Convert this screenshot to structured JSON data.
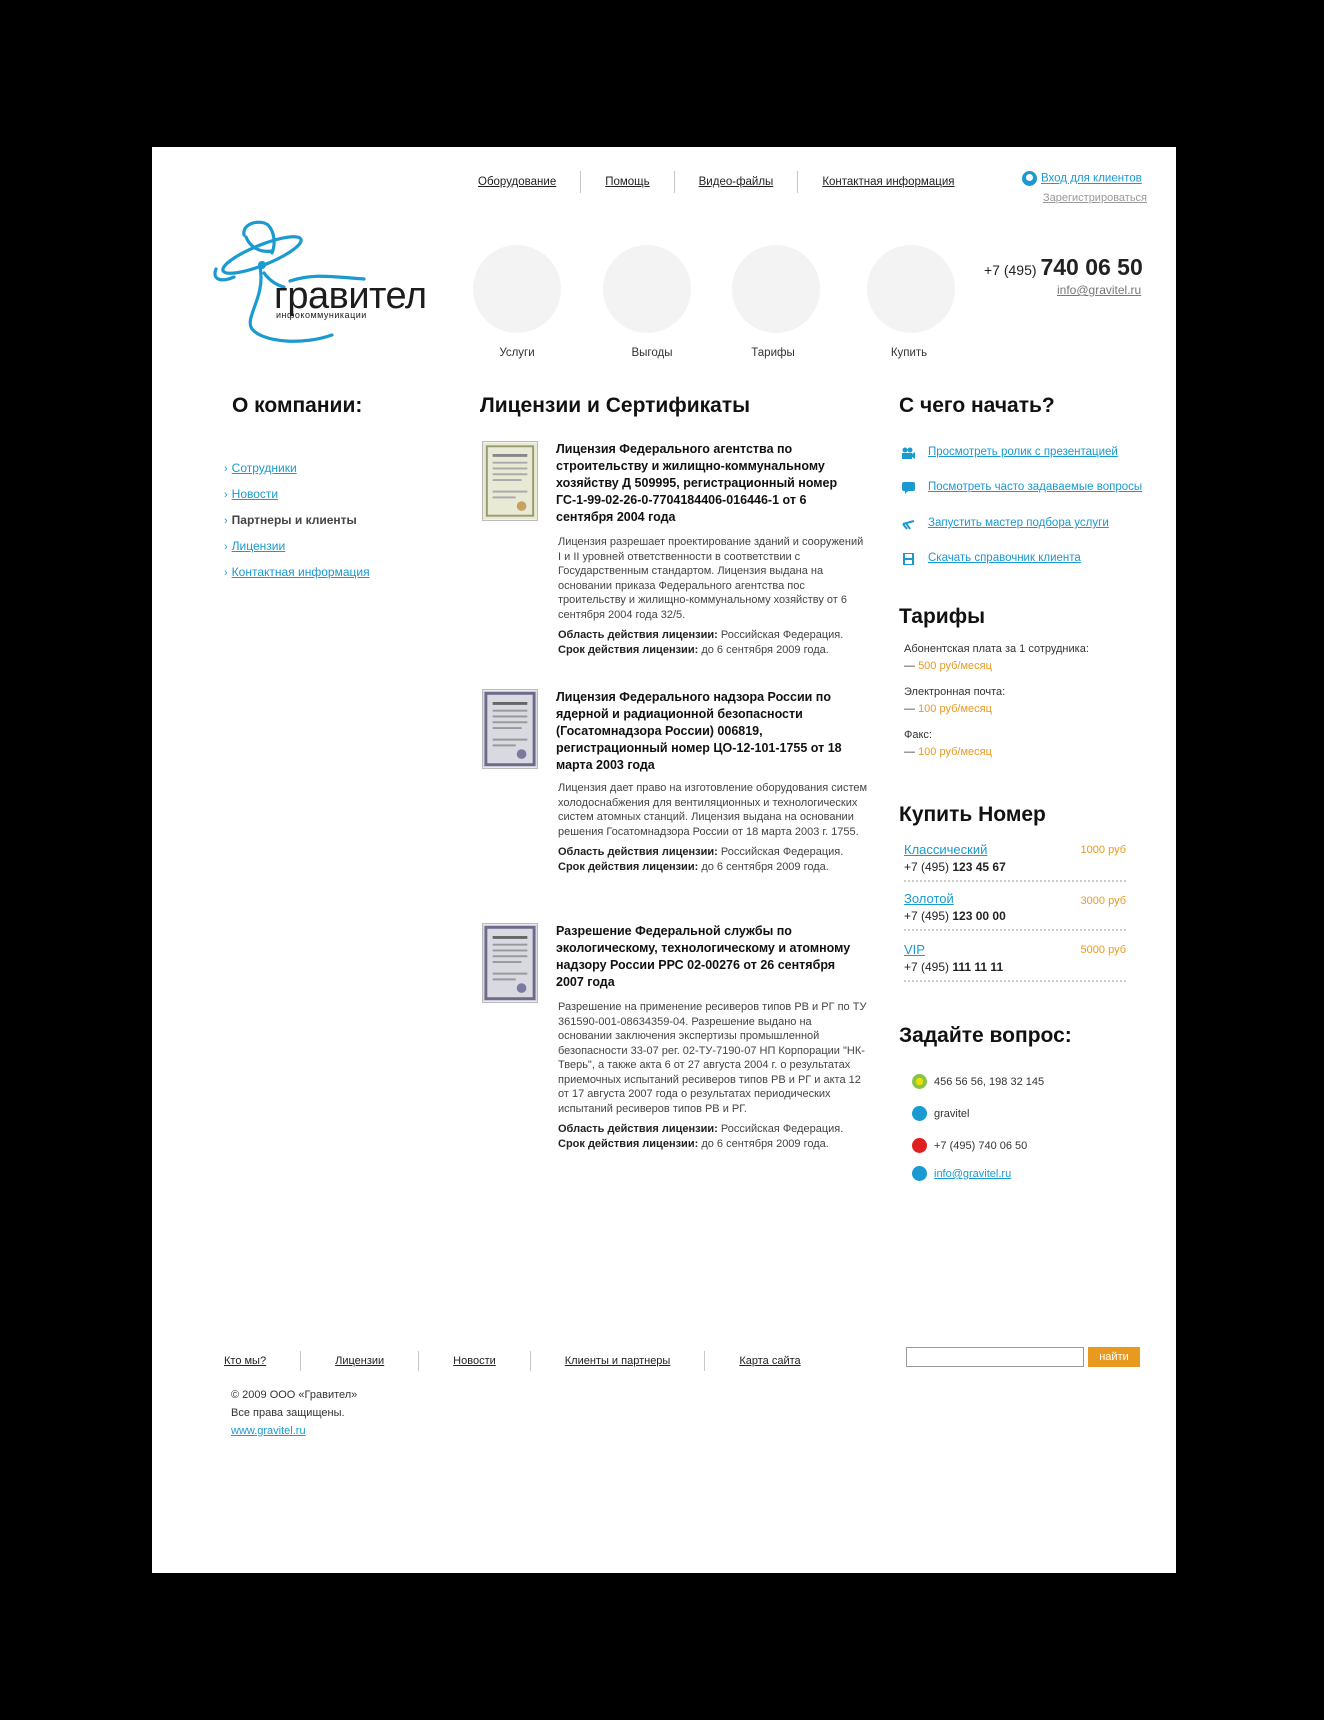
{
  "header": {
    "nav": [
      "Оборудование",
      "Помощь",
      "Видео-файлы",
      "Контактная информация"
    ],
    "login": "Вход для клиентов",
    "register": "Зарегистрироваться",
    "logo_name": "гравител",
    "logo_sub": "инфокоммуникации",
    "phone_prefix": "+7 (495)",
    "phone_main": "740 06 50",
    "email": "info@gravitel.ru",
    "circles": [
      "Услуги",
      "Выгоды",
      "Тарифы",
      "Купить"
    ]
  },
  "left": {
    "title": "О компании:",
    "items": [
      "Сотрудники",
      "Новости",
      "Партнеры и клиенты",
      "Лицензии",
      "Контактная информация"
    ]
  },
  "main": {
    "title": "Лицензии и Сертификаты",
    "licenses": [
      {
        "title": "Лицензия Федерального агентства по строительству и жилищно-коммунальному хозяйству Д 509995, регистрационный номер ГС-1-99-02-26-0-7704184406-016446-1 от 6 сентября 2004 года",
        "desc": "Лицензия разрешает проектирование зданий и сооружений I и II уровней ответственности в соответствии с Государственным стандартом. Лицензия выдана на основании приказа Федерального агентства пос троительству и жилищно-коммунальному хозяйству от 6 сентября 2004 года 32/5.",
        "area_label": "Область действия лицензии:",
        "area": "Российская Федерация.",
        "term_label": "Срок действия лицензии:",
        "term": "до 6 сентября 2009 года."
      },
      {
        "title": "Лицензия Федерального надзора России по ядерной и радиационной безопасности (Госатомнадзора России) 006819, регистрационный номер ЦО-12-101-1755 от 18 марта 2003 года",
        "desc": "Лицензия дает право на изготовление оборудования систем холодоснабжения для вентиляционных и технологических систем атомных станций. Лицензия выдана на основании решения Госатомнадзора России от 18 марта 2003 г. 1755.",
        "area_label": "Область действия лицензии:",
        "area": "Российская Федерация.",
        "term_label": "Срок действия лицензии:",
        "term": "до 6 сентября 2009 года."
      },
      {
        "title": "Разрешение Федеральной службы по экологическому, технологическому и атомному надзору России РРС 02-00276 от 26 сентября 2007 года",
        "desc": "Разрешение на применение ресиверов типов РВ и РГ по ТУ 361590-001-08634359-04. Разрешение выдано на основании заключения экспертизы промышленной безопасности 33-07 рег. 02-ТУ-7190-07 НП Корпорации \"НК-Тверь\", а также акта 6 от 27 августа 2004 г. о результатах приемочных испытаний ресиверов типов РВ и РГ и акта 12 от 17 августа 2007 года о результатах периодических испытаний ресиверов типов РВ и РГ.",
        "area_label": "Область действия лицензии:",
        "area": "Российская Федерация.",
        "term_label": "Срок действия лицензии:",
        "term": "до 6 сентября 2009 года."
      }
    ]
  },
  "right": {
    "start_title": "С чего начать?",
    "start_items": [
      "Просмотреть ролик с презентацией",
      "Посмотреть часто задаваемые вопросы",
      "Запустить мастер подбора услуги",
      "Скачать справочник клиента"
    ],
    "tariffs_title": "Тарифы",
    "tariffs": [
      {
        "label": "Абонентская плата за 1 сотрудника:",
        "value": "500 руб/месяц"
      },
      {
        "label": "Электронная почта:",
        "value": "100 руб/месяц"
      },
      {
        "label": "Факс:",
        "value": "100 руб/месяц"
      }
    ],
    "dash": "—",
    "buy_title": "Купить Номер",
    "numbers": [
      {
        "name": "Классический",
        "price": "1000 руб",
        "prefix": "+7 (495)",
        "num": "123 45 67"
      },
      {
        "name": "Золотой",
        "price": "3000 руб",
        "prefix": "+7 (495)",
        "num": "123 00 00"
      },
      {
        "name": "VIP",
        "price": "5000 руб",
        "prefix": "+7 (495)",
        "num": "111 11 11"
      }
    ],
    "ask_title": "Задайте вопрос:",
    "ask": [
      {
        "icon": "icq-icon",
        "text": "456 56 56, 198 32 145"
      },
      {
        "icon": "skype-icon",
        "text": "gravitel"
      },
      {
        "icon": "phone-icon",
        "text": "+7 (495) 740 06 50"
      },
      {
        "icon": "mail-icon",
        "text": "info@gravitel.ru"
      }
    ]
  },
  "footer": {
    "nav": [
      "Кто мы?",
      "Лицензии",
      "Новости",
      "Клиенты и партнеры",
      "Карта сайта"
    ],
    "search_button": "найти",
    "copyright": "© 2009 ООО «Гравител»",
    "rights": "Все права защищены.",
    "site": "www.gravitel.ru"
  },
  "colors": {
    "accent": "#1a9ad0",
    "orange": "#e89a20"
  }
}
